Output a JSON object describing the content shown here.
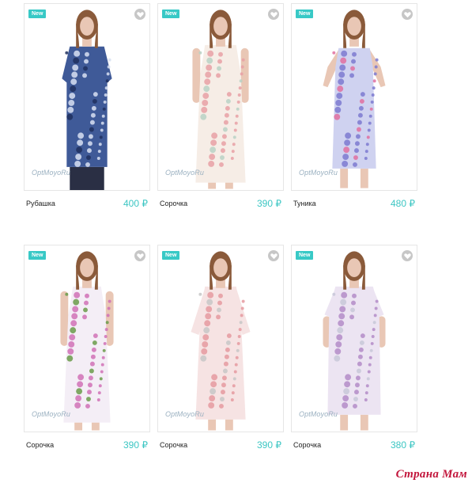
{
  "products": [
    {
      "badge": "New",
      "brand": "OptMoyoRu",
      "name": "Рубашка",
      "price": "400 ₽",
      "colors": {
        "dress": "#3f5a98",
        "pattern": "#d8e0f2",
        "alt": "#20305e",
        "legs": "#2a2f44"
      },
      "style": "shirt"
    },
    {
      "badge": "New",
      "brand": "OptMoyoRu",
      "name": "Сорочка",
      "price": "390 ₽",
      "colors": {
        "dress": "#f6ede6",
        "pattern": "#e8a0a4",
        "alt": "#b9d1c4",
        "legs": "#e9c7b5"
      },
      "style": "long"
    },
    {
      "badge": "New",
      "brand": "OptMoyoRu",
      "name": "Туника",
      "price": "480 ₽",
      "colors": {
        "dress": "#cfd2f0",
        "pattern": "#7d7ad0",
        "alt": "#e070a0",
        "legs": "#e9c7b5"
      },
      "style": "tunic"
    },
    {
      "badge": "New",
      "brand": "OptMoyoRu",
      "name": "Сорочка",
      "price": "390 ₽",
      "colors": {
        "dress": "#f4eef6",
        "pattern": "#d071b6",
        "alt": "#6a9b4a",
        "legs": "#e9c7b5"
      },
      "style": "sleeveless"
    },
    {
      "badge": "New",
      "brand": "OptMoyoRu",
      "name": "Сорочка",
      "price": "390 ₽",
      "colors": {
        "dress": "#f6e3e3",
        "pattern": "#e59aa0",
        "alt": "#c7c7c7",
        "legs": "#e9c7b5"
      },
      "style": "sleeve"
    },
    {
      "badge": "New",
      "brand": "OptMoyoRu",
      "name": "Сорочка",
      "price": "380 ₽",
      "colors": {
        "dress": "#ece4f2",
        "pattern": "#b48cc8",
        "alt": "#c8c8d8",
        "legs": "#e9c7b5"
      },
      "style": "short"
    }
  ],
  "watermark": "Страна Мам"
}
